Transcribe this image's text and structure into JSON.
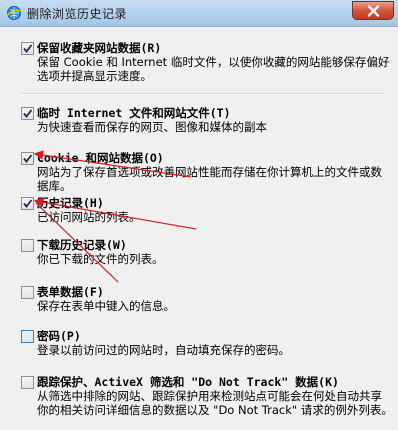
{
  "window": {
    "title": "删除浏览历史记录",
    "close_icon": "close-icon",
    "title_icon": "ie-globe-icon"
  },
  "options": [
    {
      "key": "favorites",
      "checked": true,
      "label": "保留收藏夹网站数据(R)",
      "desc": "保留 Cookie 和 Internet 临时文件，以使你收藏的网站能够保存偏好选项并提高显示速度。"
    },
    {
      "key": "temp_files",
      "checked": true,
      "label": "临时 Internet 文件和网站文件(T)",
      "desc": "为快速查看而保存的网页、图像和媒体的副本"
    },
    {
      "key": "cookies",
      "checked": true,
      "label": "Cookie 和网站数据(O)",
      "desc": "网站为了保存首选项或改善网站性能而存储在你计算机上的文件或数据库。"
    },
    {
      "key": "history",
      "checked": true,
      "label": "历史记录(H)",
      "desc": "已访问网站的列表。"
    },
    {
      "key": "downloads",
      "checked": false,
      "label": "下载历史记录(W)",
      "desc": "你已下载的文件的列表。"
    },
    {
      "key": "form_data",
      "checked": false,
      "label": "表单数据(F)",
      "desc": "保存在表单中键入的信息。"
    },
    {
      "key": "passwords",
      "checked": false,
      "label": "密码(P)",
      "desc": "登录以前访问过的网站时，自动填充保存的密码。"
    },
    {
      "key": "tracking",
      "checked": false,
      "label": "跟踪保护、ActiveX 筛选和 \"Do Not Track\" 数据(K)",
      "desc": "从筛选中排除的网站、跟踪保护用来检测站点可能会在何处自动共享你的相关访问详细信息的数据以及 \"Do Not Track\" 请求的例外列表。"
    }
  ],
  "colors": {
    "annotation_arrow": "#d42020",
    "checkbox_border": "#8e8f8f",
    "checkbox_focus_border": "#3c7fb1"
  }
}
